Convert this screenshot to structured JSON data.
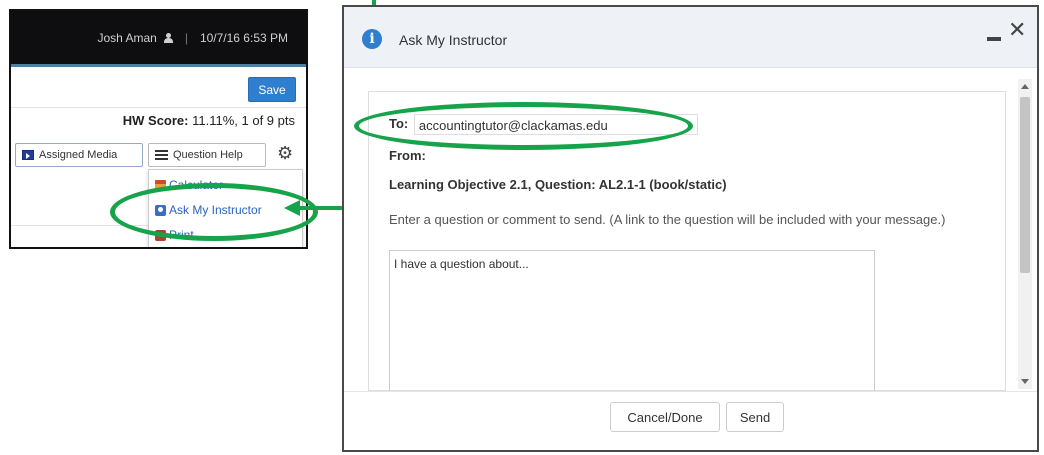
{
  "header": {
    "user_name": "Josh Aman",
    "datetime": "10/7/16 6:53 PM",
    "separator": "|"
  },
  "toolbar": {
    "save_label": "Save",
    "score_label": "HW Score:",
    "score_value": "11.11%, 1 of 9 pts",
    "assigned_media_label": "Assigned Media",
    "question_help_label": "Question Help"
  },
  "menu": {
    "items": [
      {
        "label": "Calculator",
        "icon": "calculator-icon"
      },
      {
        "label": "Ask My Instructor",
        "icon": "ask-instructor-icon"
      },
      {
        "label": "Print",
        "icon": "print-icon"
      }
    ]
  },
  "dialog": {
    "title": "Ask My Instructor",
    "to_label": "To:",
    "to_value": "accountingtutor@clackamas.edu",
    "from_label": "From:",
    "from_value": "",
    "subject": "Learning Objective 2.1, Question: AL2.1-1 (book/static)",
    "prompt": "Enter a question or comment to send. (A link to the question will be included with your message.)",
    "message_value": "I have a question about...",
    "cancel_label": "Cancel/Done",
    "send_label": "Send"
  },
  "colors": {
    "accent_blue": "#2f7fd1",
    "annotation_green": "#17a34a",
    "topbar_black": "#0e0e10"
  }
}
